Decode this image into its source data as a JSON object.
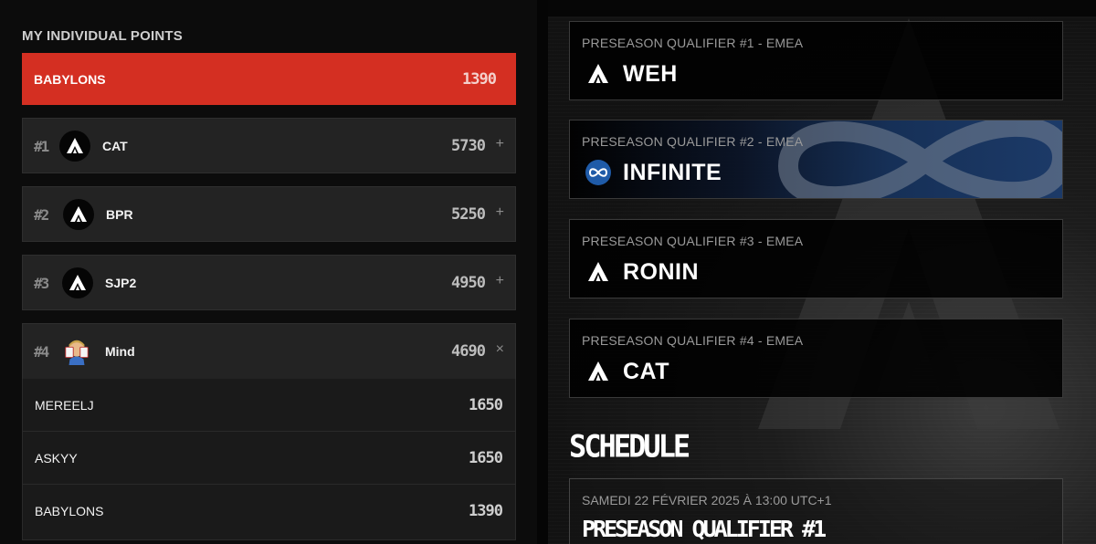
{
  "individual": {
    "title": "MY INDIVIDUAL POINTS",
    "me": {
      "name": "BABYLONS",
      "points": "1390"
    },
    "teams": [
      {
        "rank": "#1",
        "name": "CAT",
        "points": "5730",
        "toggle": "+",
        "icon": "apex-logo-icon"
      },
      {
        "rank": "#2",
        "name": "BPR",
        "points": "5250",
        "toggle": "+",
        "icon": "apex-logo-icon"
      },
      {
        "rank": "#3",
        "name": "SJP2",
        "points": "4950",
        "toggle": "+",
        "icon": "apex-logo-icon"
      },
      {
        "rank": "#4",
        "name": "Mind",
        "points": "4690",
        "toggle": "×",
        "icon": "mind-avatar-icon"
      }
    ],
    "members": [
      {
        "name": "MEREELJ",
        "points": "1650"
      },
      {
        "name": "ASKYY",
        "points": "1650"
      },
      {
        "name": "BABYLONS",
        "points": "1390"
      }
    ]
  },
  "qualifiers": [
    {
      "label": "PRESEASON QUALIFIER #1 - EMEA",
      "winner": "WEH",
      "icon": "apex-logo-icon"
    },
    {
      "label": "PRESEASON QUALIFIER #2 - EMEA",
      "winner": "INFINITE",
      "icon": "infinite-logo-icon"
    },
    {
      "label": "PRESEASON QUALIFIER #3 - EMEA",
      "winner": "RONIN",
      "icon": "apex-logo-icon"
    },
    {
      "label": "PRESEASON QUALIFIER #4 - EMEA",
      "winner": "CAT",
      "icon": "apex-logo-icon"
    }
  ],
  "schedule": {
    "title": "SCHEDULE",
    "events": [
      {
        "date": "SAMEDI 22 FÉVRIER 2025 À 13:00 UTC+1",
        "name": "PRESEASON QUALIFIER #1"
      }
    ]
  },
  "colors": {
    "accent": "#d42f22",
    "row_bg": "#232323",
    "infinite_blue": "#1c3a68"
  }
}
